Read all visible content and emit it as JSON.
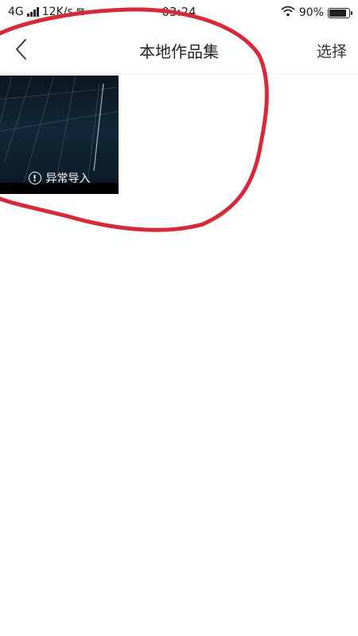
{
  "status_bar": {
    "network": "4G",
    "speed": "12K/s",
    "time": "03:24",
    "battery_percent": "90%",
    "battery_level": 0.9
  },
  "nav": {
    "back_icon": "chevron-left-icon",
    "title": "本地作品集",
    "select_label": "选择"
  },
  "works": [
    {
      "status_label": "异常导入",
      "status_icon": "exclamation-circle-icon"
    }
  ],
  "colors": {
    "annotation_red": "#d62a3a",
    "thumbnail_bg": "#000000"
  }
}
